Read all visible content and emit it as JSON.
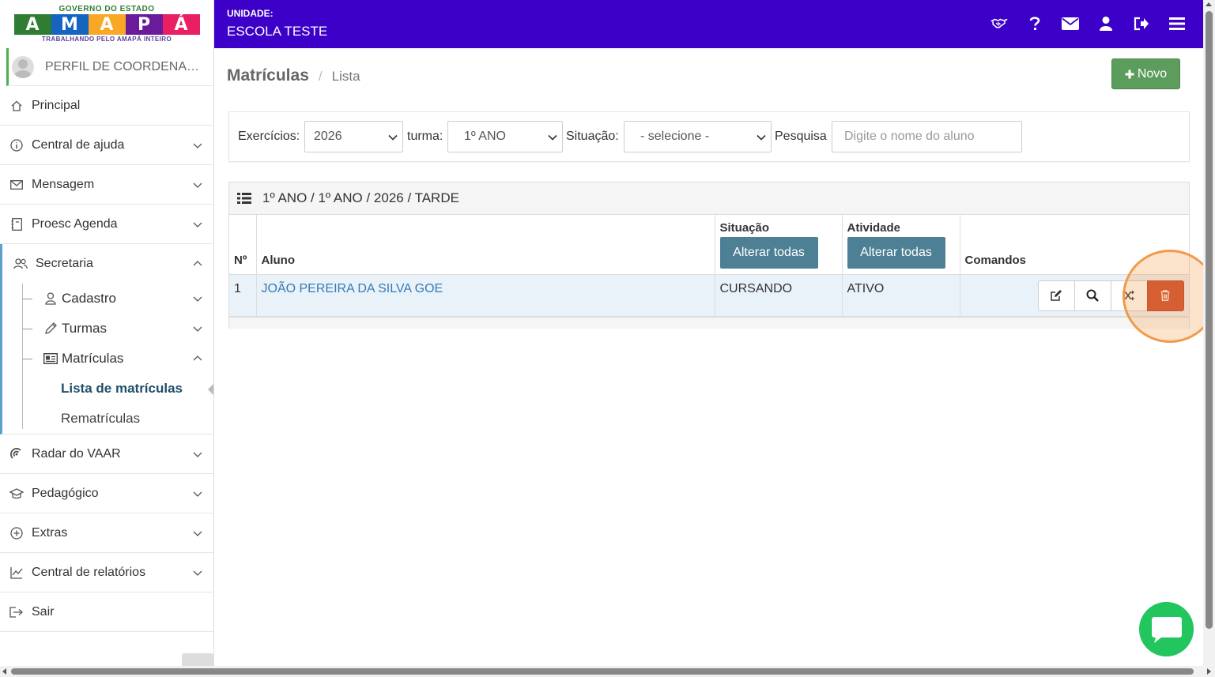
{
  "logo": {
    "top": "GOVERNO DO ESTADO",
    "letters": [
      "A",
      "M",
      "A",
      "P",
      "Á"
    ],
    "bottom": "TRABALHANDO PELO AMAPÁ INTEIRO"
  },
  "header": {
    "unit_label": "UNIDADE:",
    "unit_name": "ESCOLA TESTE",
    "icons": [
      "handshake-icon",
      "help-icon",
      "mail-icon",
      "user-icon",
      "logout-icon",
      "menu-icon"
    ],
    "bg_color": "#3d00c8"
  },
  "sidebar": {
    "profile": "PERFIL DE COORDENAÇÃO",
    "items": [
      {
        "label": "Principal",
        "icon": "home-icon"
      },
      {
        "label": "Central de ajuda",
        "icon": "info-icon"
      },
      {
        "label": "Mensagem",
        "icon": "envelope-icon"
      },
      {
        "label": "Proesc Agenda",
        "icon": "agenda-icon"
      },
      {
        "label": "Secretaria",
        "icon": "users-icon"
      },
      {
        "label": "Radar do VAAR",
        "icon": "radar-icon"
      },
      {
        "label": "Pedagógico",
        "icon": "graduation-cap-icon"
      },
      {
        "label": "Extras",
        "icon": "plus-circle-icon"
      },
      {
        "label": "Central de relatórios",
        "icon": "chart-icon"
      },
      {
        "label": "Sair",
        "icon": "exit-icon"
      }
    ],
    "secretaria_children": [
      {
        "label": "Cadastro",
        "icon": "user-icon"
      },
      {
        "label": "Turmas",
        "icon": "pencil-icon"
      },
      {
        "label": "Matrículas",
        "icon": "id-card-icon"
      }
    ],
    "matriculas_children": [
      {
        "label": "Lista de matrículas",
        "active": true
      },
      {
        "label": "Rematrículas",
        "active": false
      }
    ]
  },
  "page": {
    "title": "Matrículas",
    "separator": "/",
    "subtitle": "Lista",
    "new_button": "Novo"
  },
  "filters": {
    "exercicios_label": "Exercícios:",
    "exercicios_value": "2026",
    "turma_label": "turma:",
    "turma_value": "1º ANO",
    "situacao_label": "Situação:",
    "situacao_value": "- selecione -",
    "pesquisa_label": "Pesquisa",
    "pesquisa_placeholder": "Digite o nome do aluno"
  },
  "table": {
    "title": "1º ANO / 1º ANO / 2026 / TARDE",
    "columns": {
      "num": "Nº",
      "aluno": "Aluno",
      "situacao": "Situação",
      "atividade": "Atividade",
      "comandos": "Comandos"
    },
    "alter_all_label": "Alterar todas",
    "rows": [
      {
        "num": "1",
        "aluno": "JOÃO PEREIRA DA SILVA GOE",
        "situacao": "CURSANDO",
        "atividade": "ATIVO"
      }
    ],
    "commands": [
      "edit-icon",
      "search-icon",
      "shuffle-icon",
      "trash-icon"
    ]
  },
  "colors": {
    "accent_primary": "#3d00c8",
    "button_success": "#5c9c5c",
    "button_info": "#4d7f95",
    "button_danger": "#c9472b",
    "link": "#337ab7",
    "highlight": "#f29a4a",
    "chat": "#22c55e"
  }
}
